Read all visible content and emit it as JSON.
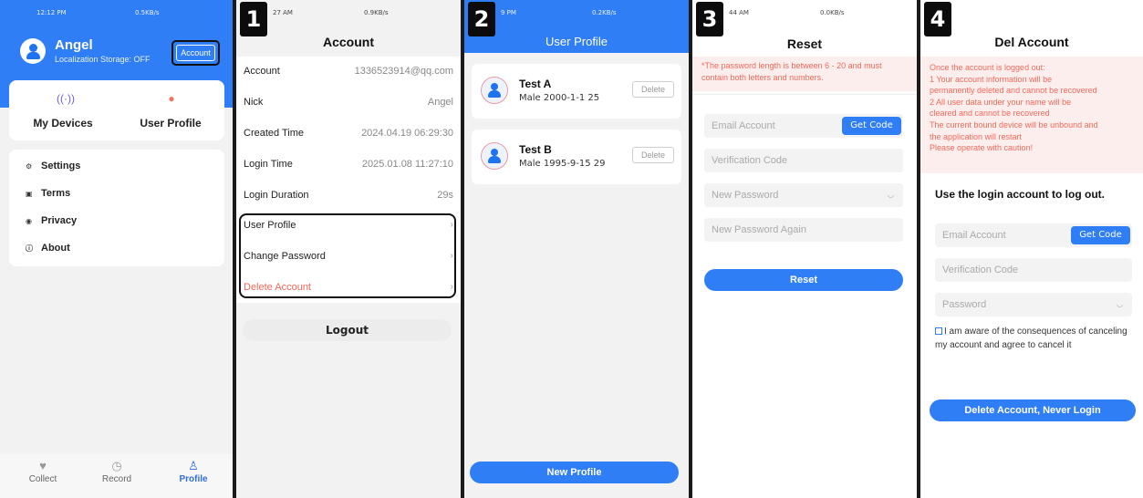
{
  "colors": {
    "accent": "#2f7ef5",
    "danger": "#ef6a5a",
    "highlight_box": "#111111"
  },
  "panel0": {
    "status": {
      "time": "12:12 PM",
      "right": "0.5KB/s"
    },
    "user_name": "Angel",
    "storage": "Localization Storage: OFF",
    "account_button": "Account",
    "cards": [
      {
        "icon": "wireless-icon",
        "label": "My Devices"
      },
      {
        "icon": "user-icon",
        "label": "User Profile"
      }
    ],
    "menu": [
      {
        "icon": "gear-icon",
        "label": "Settings"
      },
      {
        "icon": "document-icon",
        "label": "Terms"
      },
      {
        "icon": "shield-icon",
        "label": "Privacy"
      },
      {
        "icon": "info-icon",
        "label": "About"
      }
    ],
    "tabs": [
      {
        "icon": "heart-icon",
        "label": "Collect"
      },
      {
        "icon": "clock-icon",
        "label": "Record"
      },
      {
        "icon": "person-icon",
        "label": "Profile",
        "active": true
      }
    ]
  },
  "panel1": {
    "badge": "1",
    "status": {
      "time": "27 AM",
      "right": "0.9KB/s"
    },
    "title": "Account",
    "rows": [
      {
        "key": "Account",
        "value": "1336523914@qq.com"
      },
      {
        "key": "Nick",
        "value": "Angel"
      },
      {
        "key": "Created Time",
        "value": "2024.04.19 06:29:30"
      },
      {
        "key": "Login Time",
        "value": "2025.01.08 11:27:10"
      },
      {
        "key": "Login Duration",
        "value": "29s"
      }
    ],
    "links": [
      "User Profile",
      "Change Password",
      "Delete Account"
    ],
    "logout": "Logout"
  },
  "panel2": {
    "badge": "2",
    "status": {
      "time": "9 PM",
      "right": "0.2KB/s"
    },
    "title": "User Profile",
    "profiles": [
      {
        "name": "Test A",
        "info": "Male  2000-1-1  25",
        "delete": "Delete"
      },
      {
        "name": "Test B",
        "info": "Male  1995-9-15  29",
        "delete": "Delete"
      }
    ],
    "new_profile": "New Profile"
  },
  "panel3": {
    "badge": "3",
    "status": {
      "time": "44 AM",
      "right": "0.0KB/s"
    },
    "title": "Reset",
    "warning": "*The password length is between 6 - 20 and must contain both letters and numbers.",
    "fields": {
      "email": "Email Account",
      "get_code": "Get Code",
      "code": "Verification Code",
      "new_password": "New Password",
      "new_password_again": "New Password Again"
    },
    "reset": "Reset"
  },
  "panel4": {
    "badge": "4",
    "title": "Del Account",
    "warning_lines": [
      "Once the account is logged out:",
      "1 Your account information will be",
      "permanently deleted and cannot be recovered",
      "2 All user data under your name will be",
      "cleared and cannot be recovered",
      "The current bound device will be unbound and",
      "the application will restart",
      "Please operate with caution!"
    ],
    "subtitle": "Use the login account to log out.",
    "fields": {
      "email": "Email Account",
      "get_code": "Get Code",
      "code": "Verification Code",
      "password": "Password"
    },
    "consent": "I am aware of the consequences of canceling my account and agree to cancel it",
    "delete_button": "Delete Account, Never Login"
  }
}
